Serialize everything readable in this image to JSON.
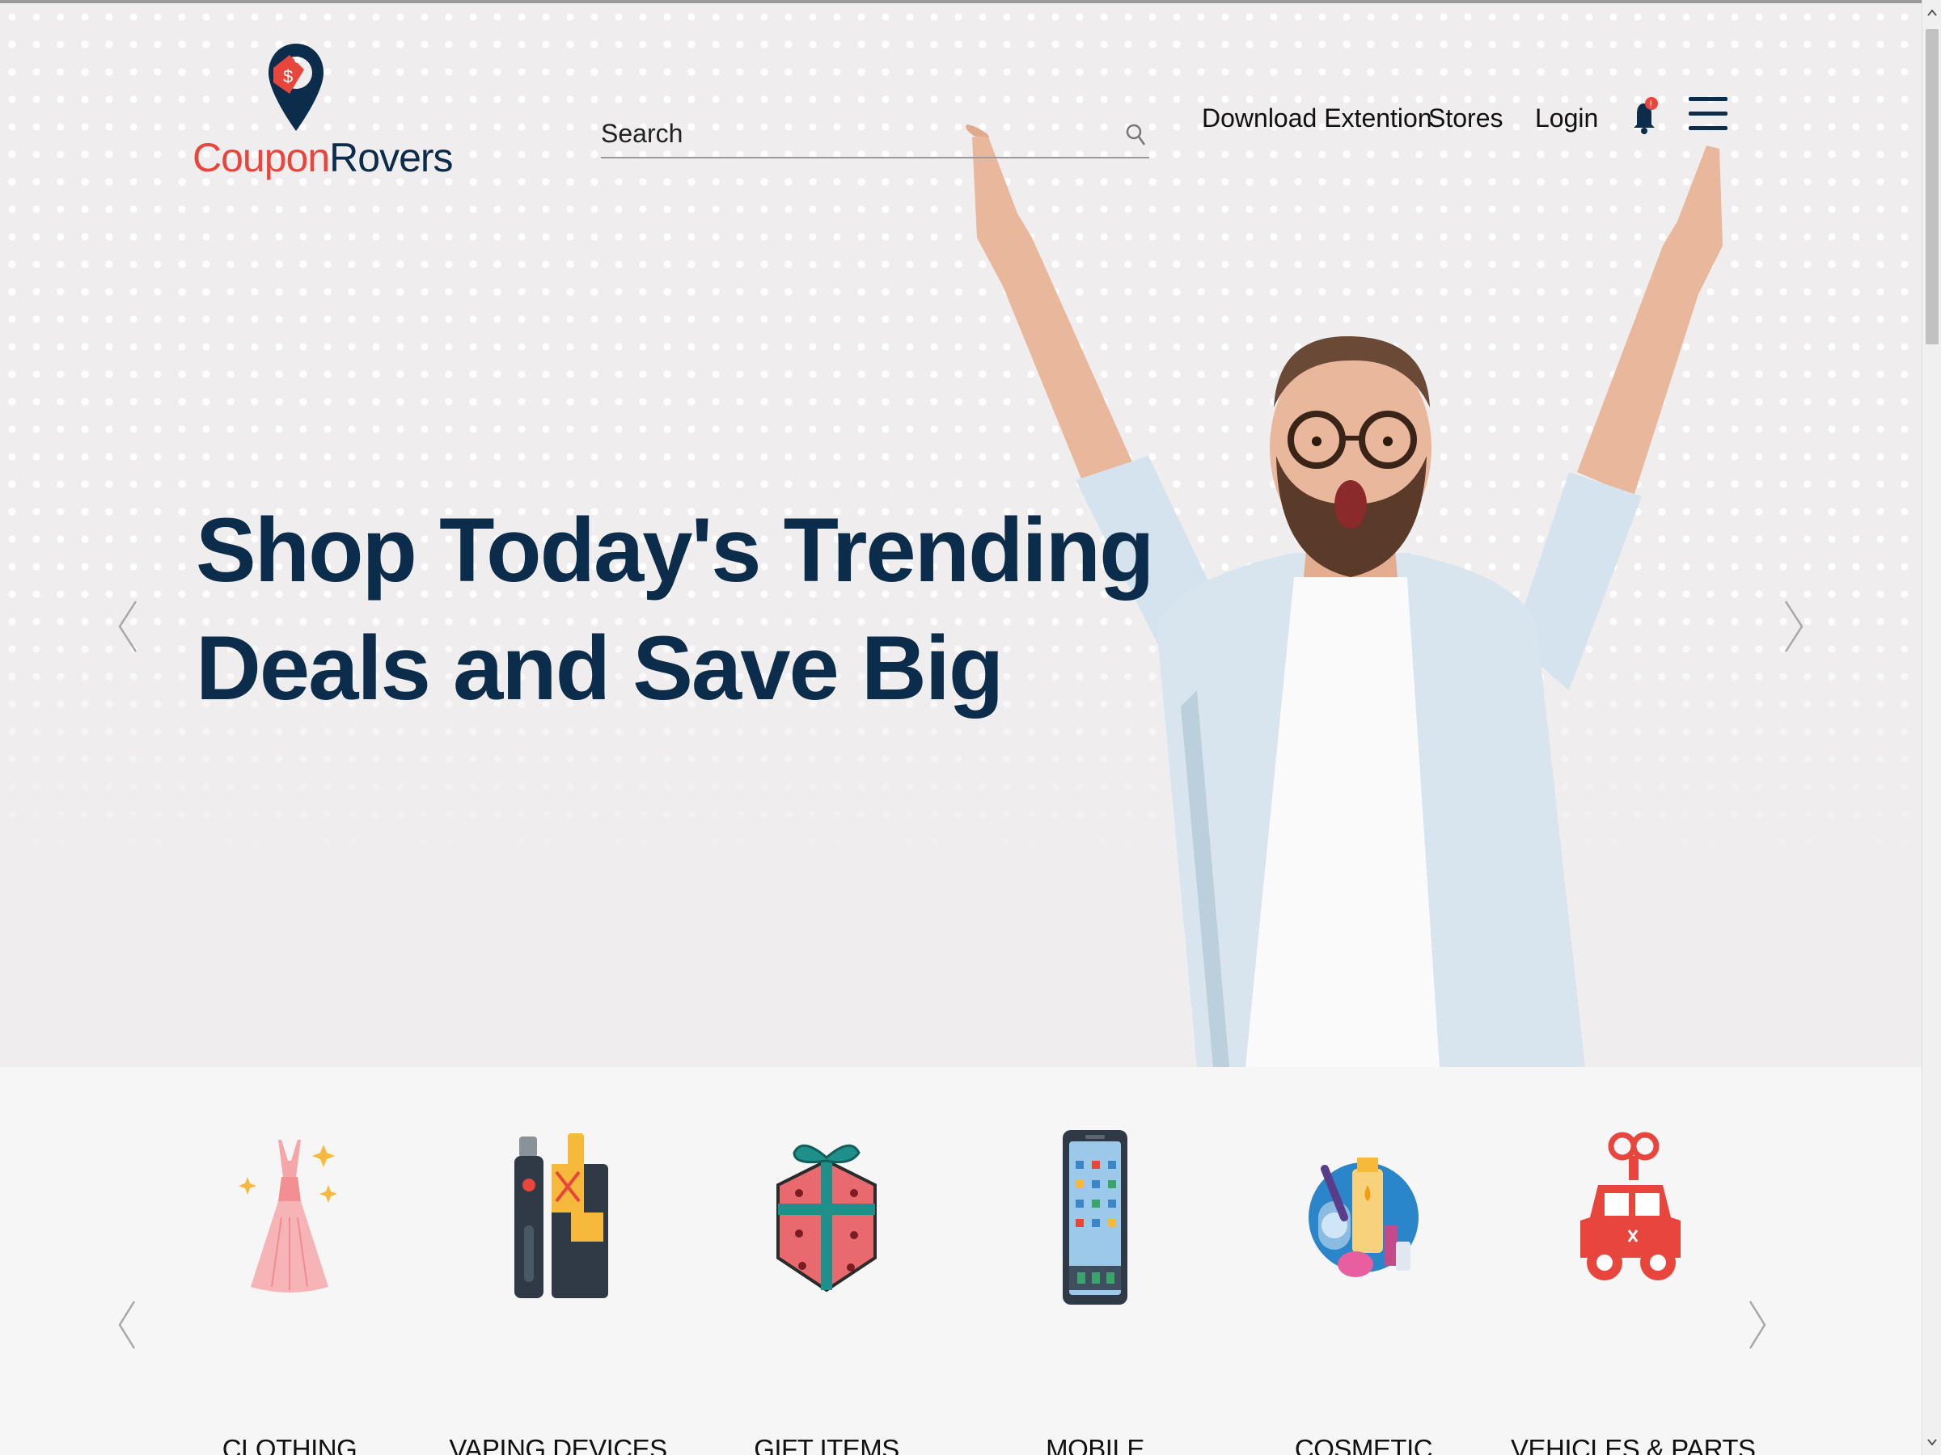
{
  "header": {
    "logo": {
      "part1": "Coupon",
      "part2": "Rovers"
    },
    "search": {
      "placeholder": "Search"
    },
    "nav": {
      "download_extension": "Download Extention",
      "stores": "Stores",
      "login": "Login"
    },
    "notification_badge": "!"
  },
  "hero": {
    "headline_line1": "Shop Today's Trending",
    "headline_line2": "Deals and Save Big"
  },
  "categories": {
    "items": [
      {
        "label": "CLOTHING",
        "icon": "dress-icon"
      },
      {
        "label": "VAPING DEVICES",
        "icon": "vape-icon"
      },
      {
        "label": "GIFT ITEMS",
        "icon": "gift-icon"
      },
      {
        "label": "MOBILE",
        "icon": "mobile-phone-icon"
      },
      {
        "label": "COSMETIC",
        "icon": "cosmetics-icon"
      },
      {
        "label": "VEHICLES & PARTS",
        "icon": "toy-car-icon"
      }
    ]
  },
  "colors": {
    "brand_red": "#e8453c",
    "brand_navy": "#0b2c4a",
    "hero_bg": "#efeded",
    "section_bg": "#f6f6f6"
  }
}
